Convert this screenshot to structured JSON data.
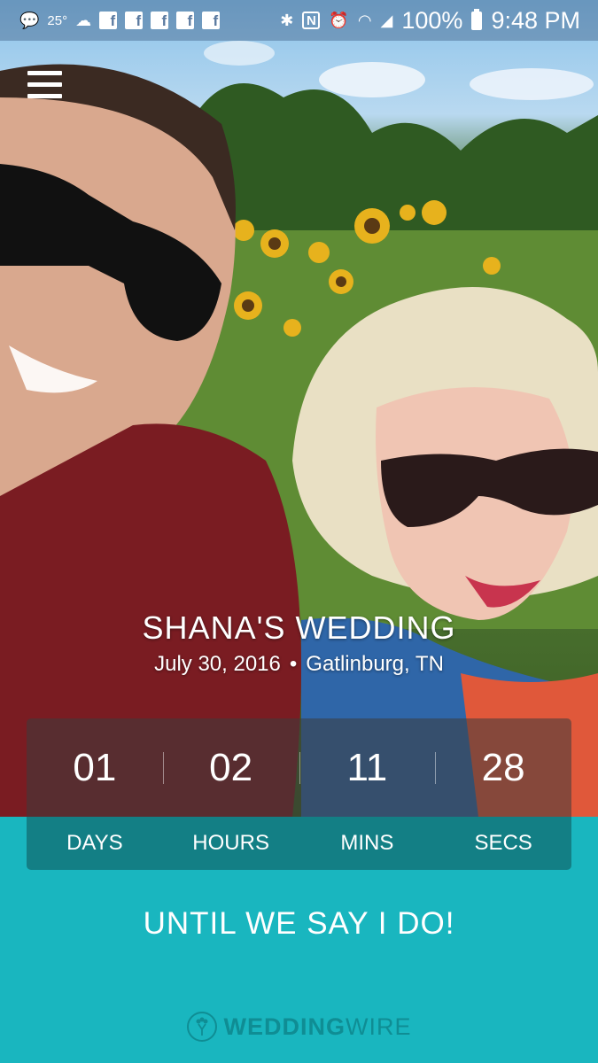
{
  "status_bar": {
    "temperature": "25°",
    "battery": "100%",
    "time": "9:48 PM",
    "icons": [
      "message-icon",
      "weather-icon",
      "facebook-icon",
      "facebook-icon",
      "facebook-icon",
      "facebook-icon",
      "facebook-icon",
      "bluetooth-icon",
      "nfc-icon",
      "alarm-icon",
      "wifi-icon",
      "signal-icon",
      "battery-icon"
    ]
  },
  "event": {
    "title": "SHANA'S WEDDING",
    "date": "July 30, 2016",
    "separator": "•",
    "location": "Gatlinburg, TN"
  },
  "countdown": {
    "days": "01",
    "hours": "02",
    "mins": "11",
    "secs": "28",
    "labels": {
      "days": "DAYS",
      "hours": "HOURS",
      "mins": "MINS",
      "secs": "SECS"
    }
  },
  "tagline": "UNTIL WE SAY I DO!",
  "brand": {
    "bold": "WEDDING",
    "light": "WIRE"
  },
  "colors": {
    "teal": "#19b6bf",
    "teal_dark": "#137f85",
    "brand_text": "#0f8d94"
  }
}
